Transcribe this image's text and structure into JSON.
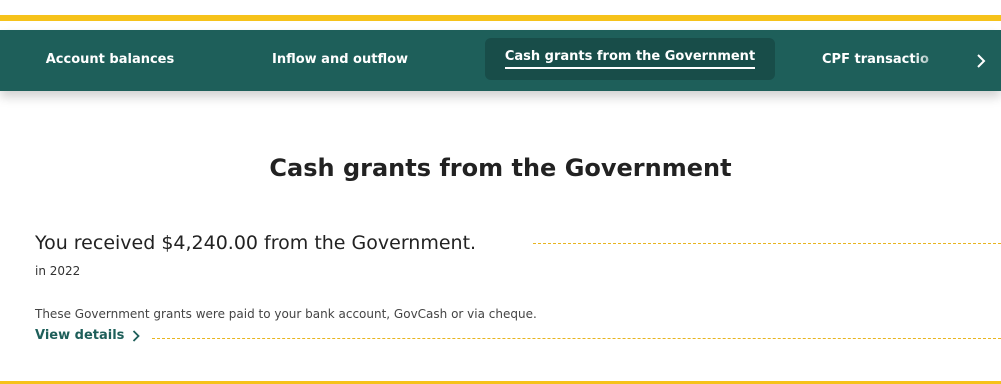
{
  "colors": {
    "accent": "#f6c21a",
    "nav_bg": "#1e5f5a",
    "nav_active_bg": "#184d49",
    "link": "#1e5f5a"
  },
  "nav": {
    "tabs": [
      {
        "label": "Account balances",
        "active": false
      },
      {
        "label": "Inflow and outflow",
        "active": false
      },
      {
        "label": "Cash grants from the Government",
        "active": true
      },
      {
        "label": "CPF transactio",
        "active": false
      }
    ],
    "next_icon": "chevron-right-icon"
  },
  "main": {
    "title": "Cash grants from the Government",
    "headline": "You received $4,240.00 from the Government.",
    "period": "in 2022",
    "description": "These Government grants were paid to your bank account, GovCash or via cheque.",
    "details_link": "View details",
    "details_icon": "chevron-right-icon"
  }
}
